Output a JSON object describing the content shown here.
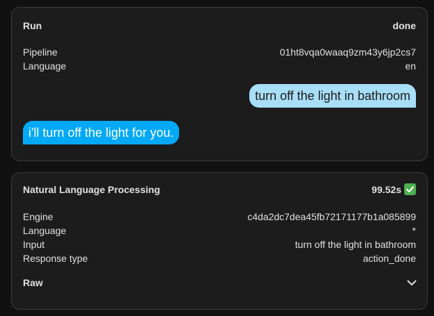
{
  "run": {
    "title": "Run",
    "status": "done",
    "rows": [
      {
        "label": "Pipeline",
        "value": "01ht8vqa0waaq9zm43y6jp2cs7"
      },
      {
        "label": "Language",
        "value": "en"
      }
    ],
    "user_message": "turn off the light in bathroom",
    "assistant_message": "i'll turn off the light for you."
  },
  "nlp": {
    "title": "Natural Language Processing",
    "duration": "99.52s",
    "status_icon": "check-mark-icon",
    "rows": [
      {
        "label": "Engine",
        "value": "c4da2dc7dea45fb72171177b1a085899"
      },
      {
        "label": "Language",
        "value": "*"
      },
      {
        "label": "Input",
        "value": "turn off the light in bathroom"
      },
      {
        "label": "Response type",
        "value": "action_done"
      }
    ],
    "raw_label": "Raw",
    "raw_icon": "chevron-down-icon"
  },
  "colors": {
    "background": "#111111",
    "card": "#1c1c1c",
    "user_bubble": "#a8def6",
    "assistant_bubble": "#03a9f4",
    "success": "#4caf50"
  }
}
